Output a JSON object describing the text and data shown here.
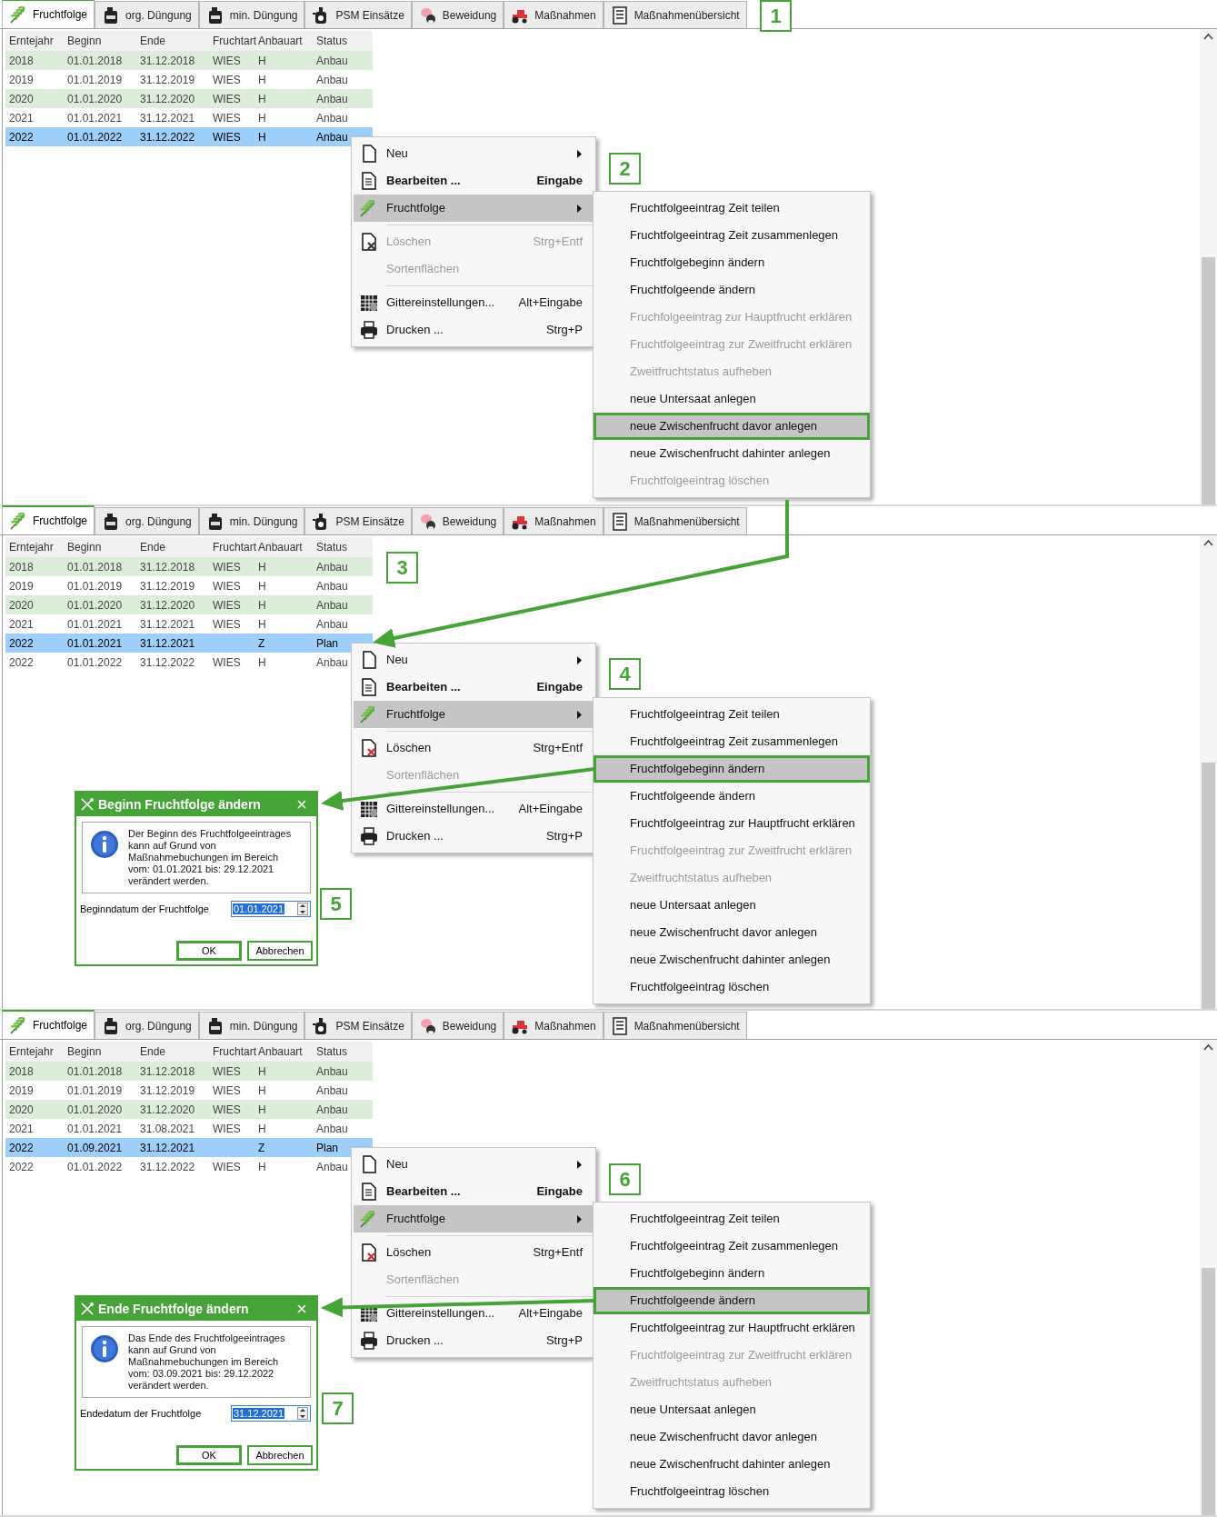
{
  "panels": [
    {
      "tabs": [
        {
          "label": "Fruchtfolge",
          "selected": true
        },
        {
          "label": "org. Düngung",
          "selected": false
        },
        {
          "label": "min. Düngung",
          "selected": false
        },
        {
          "label": "PSM Einsätze",
          "selected": false
        },
        {
          "label": "Beweidung",
          "selected": false
        },
        {
          "label": "Maßnahmen",
          "selected": false
        },
        {
          "label": "Maßnahmenübersicht",
          "selected": false
        }
      ],
      "table": {
        "columns": [
          "Erntejahr",
          "Beginn",
          "Ende",
          "Fruchtart",
          "Anbauart",
          "Status"
        ],
        "rows": [
          {
            "year": "2018",
            "begin": "01.01.2018",
            "end": "31.12.2018",
            "crop": "WIES",
            "type": "H",
            "status": "Anbau",
            "selected": false
          },
          {
            "year": "2019",
            "begin": "01.01.2019",
            "end": "31.12.2019",
            "crop": "WIES",
            "type": "H",
            "status": "Anbau",
            "selected": false
          },
          {
            "year": "2020",
            "begin": "01.01.2020",
            "end": "31.12.2020",
            "crop": "WIES",
            "type": "H",
            "status": "Anbau",
            "selected": false
          },
          {
            "year": "2021",
            "begin": "01.01.2021",
            "end": "31.12.2021",
            "crop": "WIES",
            "type": "H",
            "status": "Anbau",
            "selected": false
          },
          {
            "year": "2022",
            "begin": "01.01.2022",
            "end": "31.12.2022",
            "crop": "WIES",
            "type": "H",
            "status": "Anbau",
            "selected": true
          }
        ]
      },
      "context_menu": [
        {
          "kind": "item",
          "label": "Neu",
          "has_submenu": true,
          "disabled": false,
          "selected": false,
          "default": false
        },
        {
          "kind": "item",
          "label": "Bearbeiten ...",
          "shortcut": "Eingabe",
          "has_submenu": false,
          "disabled": false,
          "selected": false,
          "default": true
        },
        {
          "kind": "item",
          "label": "Fruchtfolge",
          "has_submenu": true,
          "disabled": false,
          "selected": true,
          "default": false
        },
        {
          "kind": "separator"
        },
        {
          "kind": "item",
          "label": "Löschen",
          "shortcut": "Strg+Entf",
          "has_submenu": false,
          "disabled": true,
          "selected": false,
          "default": false
        },
        {
          "kind": "item",
          "label": "Sortenflächen",
          "has_submenu": false,
          "disabled": true,
          "selected": false,
          "default": false
        },
        {
          "kind": "separator"
        },
        {
          "kind": "item",
          "label": "Gittereinstellungen...",
          "shortcut": "Alt+Eingabe",
          "has_submenu": false,
          "disabled": false,
          "selected": false,
          "default": false
        },
        {
          "kind": "item",
          "label": "Drucken ...",
          "shortcut": "Strg+P",
          "has_submenu": false,
          "disabled": false,
          "selected": false,
          "default": false
        }
      ],
      "submenu": [
        {
          "label": "Fruchtfolgeeintrag Zeit teilen",
          "disabled": false,
          "selected": false
        },
        {
          "label": "Fruchtfolgeeintrag Zeit zusammenlegen",
          "disabled": false,
          "selected": false
        },
        {
          "label": "Fruchtfolgebeginn ändern",
          "disabled": false,
          "selected": false
        },
        {
          "label": "Fruchtfolgeende ändern",
          "disabled": false,
          "selected": false
        },
        {
          "label": "Fruchfolgeeintrag zur Hauptfrucht erklären",
          "disabled": true,
          "selected": false
        },
        {
          "label": "Fruchtfolgeeintrag zur Zweitfrucht erklären",
          "disabled": true,
          "selected": false
        },
        {
          "label": "Zweitfruchtstatus aufheben",
          "disabled": true,
          "selected": false
        },
        {
          "label": "neue Untersaat anlegen",
          "disabled": false,
          "selected": false
        },
        {
          "label": "neue Zwischenfrucht davor anlegen",
          "disabled": false,
          "selected": true
        },
        {
          "label": "neue Zwischenfrucht dahinter anlegen",
          "disabled": false,
          "selected": false
        },
        {
          "label": "Fruchtfolgeeintrag löschen",
          "disabled": true,
          "selected": false
        }
      ],
      "callouts": [
        "1",
        "2"
      ]
    },
    {
      "tabs": [
        {
          "label": "Fruchtfolge",
          "selected": true
        },
        {
          "label": "org. Düngung",
          "selected": false
        },
        {
          "label": "min. Düngung",
          "selected": false
        },
        {
          "label": "PSM Einsätze",
          "selected": false
        },
        {
          "label": "Beweidung",
          "selected": false
        },
        {
          "label": "Maßnahmen",
          "selected": false
        },
        {
          "label": "Maßnahmenübersicht",
          "selected": false
        }
      ],
      "table": {
        "columns": [
          "Erntejahr",
          "Beginn",
          "Ende",
          "Fruchtart",
          "Anbauart",
          "Status"
        ],
        "rows": [
          {
            "year": "2018",
            "begin": "01.01.2018",
            "end": "31.12.2018",
            "crop": "WIES",
            "type": "H",
            "status": "Anbau",
            "selected": false
          },
          {
            "year": "2019",
            "begin": "01.01.2019",
            "end": "31.12.2019",
            "crop": "WIES",
            "type": "H",
            "status": "Anbau",
            "selected": false
          },
          {
            "year": "2020",
            "begin": "01.01.2020",
            "end": "31.12.2020",
            "crop": "WIES",
            "type": "H",
            "status": "Anbau",
            "selected": false
          },
          {
            "year": "2021",
            "begin": "01.01.2021",
            "end": "31.12.2021",
            "crop": "WIES",
            "type": "H",
            "status": "Anbau",
            "selected": false
          },
          {
            "year": "2022",
            "begin": "01.01.2021",
            "end": "31.12.2021",
            "type": "Z",
            "status": "Plan",
            "selected": true
          },
          {
            "year": "2022",
            "begin": "01.01.2022",
            "end": "31.12.2022",
            "crop": "WIES",
            "type": "H",
            "status": "Anbau",
            "selected": false
          }
        ]
      },
      "context_menu": [
        {
          "kind": "item",
          "label": "Neu",
          "has_submenu": true,
          "disabled": false,
          "selected": false,
          "default": false
        },
        {
          "kind": "item",
          "label": "Bearbeiten ...",
          "shortcut": "Eingabe",
          "has_submenu": false,
          "disabled": false,
          "selected": false,
          "default": true
        },
        {
          "kind": "item",
          "label": "Fruchtfolge",
          "has_submenu": true,
          "disabled": false,
          "selected": true,
          "default": false
        },
        {
          "kind": "separator"
        },
        {
          "kind": "item",
          "label": "Löschen",
          "shortcut": "Strg+Entf",
          "has_submenu": false,
          "disabled": false,
          "selected": false,
          "default": false
        },
        {
          "kind": "item",
          "label": "Sortenflächen",
          "has_submenu": false,
          "disabled": true,
          "selected": false,
          "default": false
        },
        {
          "kind": "separator"
        },
        {
          "kind": "item",
          "label": "Gittereinstellungen...",
          "shortcut": "Alt+Eingabe",
          "has_submenu": false,
          "disabled": false,
          "selected": false,
          "default": false
        },
        {
          "kind": "item",
          "label": "Drucken ...",
          "shortcut": "Strg+P",
          "has_submenu": false,
          "disabled": false,
          "selected": false,
          "default": false
        }
      ],
      "submenu": [
        {
          "label": "Fruchtfolgeeintrag Zeit teilen",
          "disabled": false,
          "selected": false
        },
        {
          "label": "Fruchtfolgeeintrag Zeit zusammenlegen",
          "disabled": false,
          "selected": false
        },
        {
          "label": "Fruchtfolgebeginn ändern",
          "disabled": false,
          "selected": true
        },
        {
          "label": "Fruchtfolgeende ändern",
          "disabled": false,
          "selected": false
        },
        {
          "label": "Fruchtfolgeeintrag zur Hauptfrucht erklären",
          "disabled": false,
          "selected": false
        },
        {
          "label": "Fruchtfolgeeintrag zur Zweitfrucht erklären",
          "disabled": true,
          "selected": false
        },
        {
          "label": "Zweitfruchtstatus aufheben",
          "disabled": true,
          "selected": false
        },
        {
          "label": "neue Untersaat anlegen",
          "disabled": false,
          "selected": false
        },
        {
          "label": "neue Zwischenfrucht davor anlegen",
          "disabled": false,
          "selected": false
        },
        {
          "label": "neue Zwischenfrucht dahinter anlegen",
          "disabled": false,
          "selected": false
        },
        {
          "label": "Fruchtfolgeeintrag löschen",
          "disabled": false,
          "selected": false
        }
      ],
      "dialog": {
        "title": "Beginn Fruchtfolge ändern",
        "message": [
          "Der Beginn des Fruchtfolgeeintrages",
          "kann auf Grund von",
          "Maßnahmebuchungen im Bereich",
          "vom: 01.01.2021 bis: 29.12.2021",
          "verändert werden."
        ],
        "field_label": "Beginndatum der Fruchtfolge",
        "value": "01.01.2021",
        "buttons": [
          "OK",
          "Abbrechen"
        ]
      },
      "callouts": [
        "3",
        "4",
        "5"
      ]
    },
    {
      "tabs": [
        {
          "label": "Fruchtfolge",
          "selected": true
        },
        {
          "label": "org. Düngung",
          "selected": false
        },
        {
          "label": "min. Düngung",
          "selected": false
        },
        {
          "label": "PSM Einsätze",
          "selected": false
        },
        {
          "label": "Beweidung",
          "selected": false
        },
        {
          "label": "Maßnahmen",
          "selected": false
        },
        {
          "label": "Maßnahmenübersicht",
          "selected": false
        }
      ],
      "table": {
        "columns": [
          "Erntejahr",
          "Beginn",
          "Ende",
          "Fruchtart",
          "Anbauart",
          "Status"
        ],
        "rows": [
          {
            "year": "2018",
            "begin": "01.01.2018",
            "end": "31.12.2018",
            "crop": "WIES",
            "type": "H",
            "status": "Anbau",
            "selected": false
          },
          {
            "year": "2019",
            "begin": "01.01.2019",
            "end": "31.12.2019",
            "crop": "WIES",
            "type": "H",
            "status": "Anbau",
            "selected": false
          },
          {
            "year": "2020",
            "begin": "01.01.2020",
            "end": "31.12.2020",
            "crop": "WIES",
            "type": "H",
            "status": "Anbau",
            "selected": false
          },
          {
            "year": "2021",
            "begin": "01.01.2021",
            "end": "31.08.2021",
            "crop": "WIES",
            "type": "H",
            "status": "Anbau",
            "selected": false
          },
          {
            "year": "2022",
            "begin": "01.09.2021",
            "end": "31.12.2021",
            "type": "Z",
            "status": "Plan",
            "selected": true
          },
          {
            "year": "2022",
            "begin": "01.01.2022",
            "end": "31.12.2022",
            "crop": "WIES",
            "type": "H",
            "status": "Anbau",
            "selected": false
          }
        ]
      },
      "context_menu": [
        {
          "kind": "item",
          "label": "Neu",
          "has_submenu": true,
          "disabled": false,
          "selected": false,
          "default": false
        },
        {
          "kind": "item",
          "label": "Bearbeiten ...",
          "shortcut": "Eingabe",
          "has_submenu": false,
          "disabled": false,
          "selected": false,
          "default": true
        },
        {
          "kind": "item",
          "label": "Fruchtfolge",
          "has_submenu": true,
          "disabled": false,
          "selected": true,
          "default": false
        },
        {
          "kind": "separator"
        },
        {
          "kind": "item",
          "label": "Löschen",
          "shortcut": "Strg+Entf",
          "has_submenu": false,
          "disabled": false,
          "selected": false,
          "default": false
        },
        {
          "kind": "item",
          "label": "Sortenflächen",
          "has_submenu": false,
          "disabled": true,
          "selected": false,
          "default": false
        },
        {
          "kind": "separator"
        },
        {
          "kind": "item",
          "label": "Gittereinstellungen...",
          "shortcut": "Alt+Eingabe",
          "has_submenu": false,
          "disabled": false,
          "selected": false,
          "default": false
        },
        {
          "kind": "item",
          "label": "Drucken ...",
          "shortcut": "Strg+P",
          "has_submenu": false,
          "disabled": false,
          "selected": false,
          "default": false
        }
      ],
      "submenu": [
        {
          "label": "Fruchtfolgeeintrag Zeit teilen",
          "disabled": false,
          "selected": false
        },
        {
          "label": "Fruchtfolgeeintrag Zeit zusammenlegen",
          "disabled": false,
          "selected": false
        },
        {
          "label": "Fruchtfolgebeginn ändern",
          "disabled": false,
          "selected": false
        },
        {
          "label": "Fruchtfolgeende ändern",
          "disabled": false,
          "selected": true
        },
        {
          "label": "Fruchtfolgeeintrag zur Hauptfrucht erklären",
          "disabled": false,
          "selected": false
        },
        {
          "label": "Fruchtfolgeeintrag zur Zweitfrucht erklären",
          "disabled": true,
          "selected": false
        },
        {
          "label": "Zweitfruchtstatus aufheben",
          "disabled": true,
          "selected": false
        },
        {
          "label": "neue Untersaat anlegen",
          "disabled": false,
          "selected": false
        },
        {
          "label": "neue Zwischenfrucht davor anlegen",
          "disabled": false,
          "selected": false
        },
        {
          "label": "neue Zwischenfrucht dahinter anlegen",
          "disabled": false,
          "selected": false
        },
        {
          "label": "Fruchtfolgeeintrag löschen",
          "disabled": false,
          "selected": false
        }
      ],
      "dialog": {
        "title": "Ende Fruchtfolge ändern",
        "message": [
          "Das Ende des Fruchtfolgeeintrages",
          "kann auf Grund von",
          "Maßnahmebuchungen im Bereich",
          "vom: 03.09.2021 bis: 29.12.2022",
          "verändert werden."
        ],
        "field_label": "Endedatum der Fruchtfolge",
        "value": "31.12.2021",
        "buttons": [
          "OK",
          "Abbrechen"
        ]
      },
      "callouts": [
        "6",
        "7"
      ]
    }
  ]
}
